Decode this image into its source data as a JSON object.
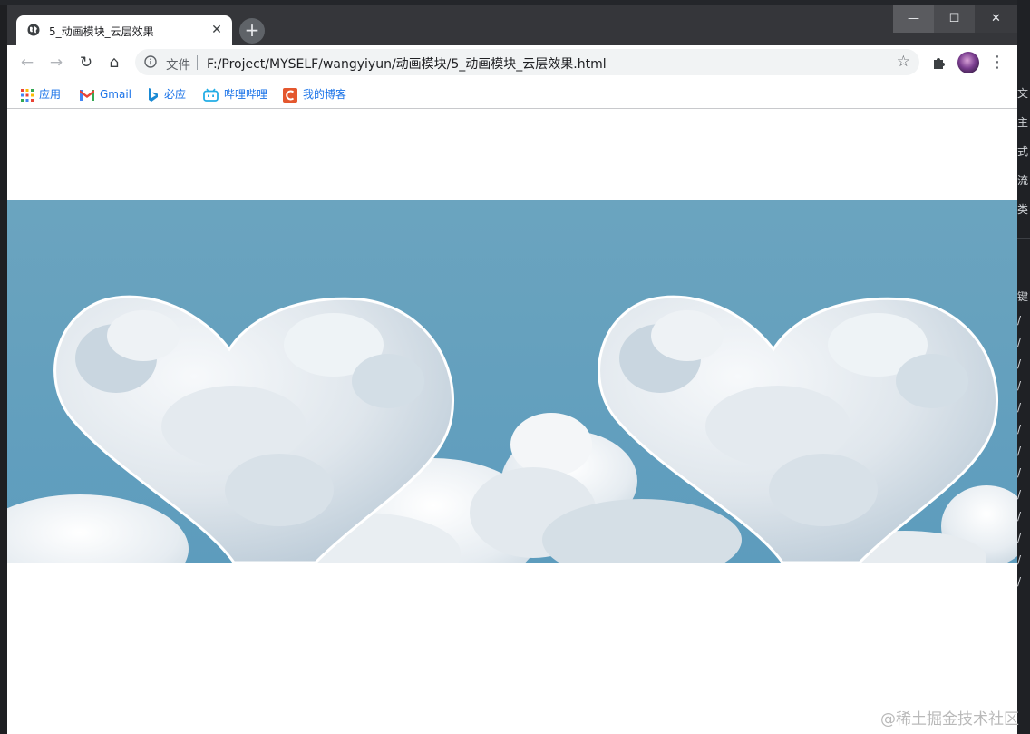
{
  "browser": {
    "tab_title": "5_动画模块_云层效果",
    "tab_close": "✕",
    "new_tab": "+",
    "window_controls": {
      "minimize": "—",
      "maximize": "☐",
      "close": "✕"
    },
    "address": {
      "security_label": "文件",
      "url": "F:/Project/MYSELF/wangyiyun/动画模块/5_动画模块_云层效果.html"
    },
    "nav": {
      "back": "←",
      "forward": "→",
      "reload": "↻",
      "home": "⌂",
      "menu": "⋮",
      "bookmark_star": "☆"
    },
    "bookmarks": [
      {
        "label": "应用",
        "icon": "apps-grid-icon"
      },
      {
        "label": "Gmail",
        "icon": "gmail-icon"
      },
      {
        "label": "必应",
        "icon": "bing-icon"
      },
      {
        "label": "哔哩哔哩",
        "icon": "bilibili-icon"
      },
      {
        "label": "我的博客",
        "icon": "csdn-icon"
      }
    ]
  },
  "page": {
    "content": "heart-clouds-banner",
    "sky_color": "#6aa5c0"
  },
  "background_ide": {
    "chars": [
      "文",
      "主",
      "式",
      "流",
      "类",
      "键",
      "/",
      "/",
      "/",
      "/",
      "/",
      "/",
      "/",
      "/",
      "/",
      "/",
      "/",
      "/",
      "/"
    ]
  },
  "watermark": "@稀土掘金技术社区"
}
